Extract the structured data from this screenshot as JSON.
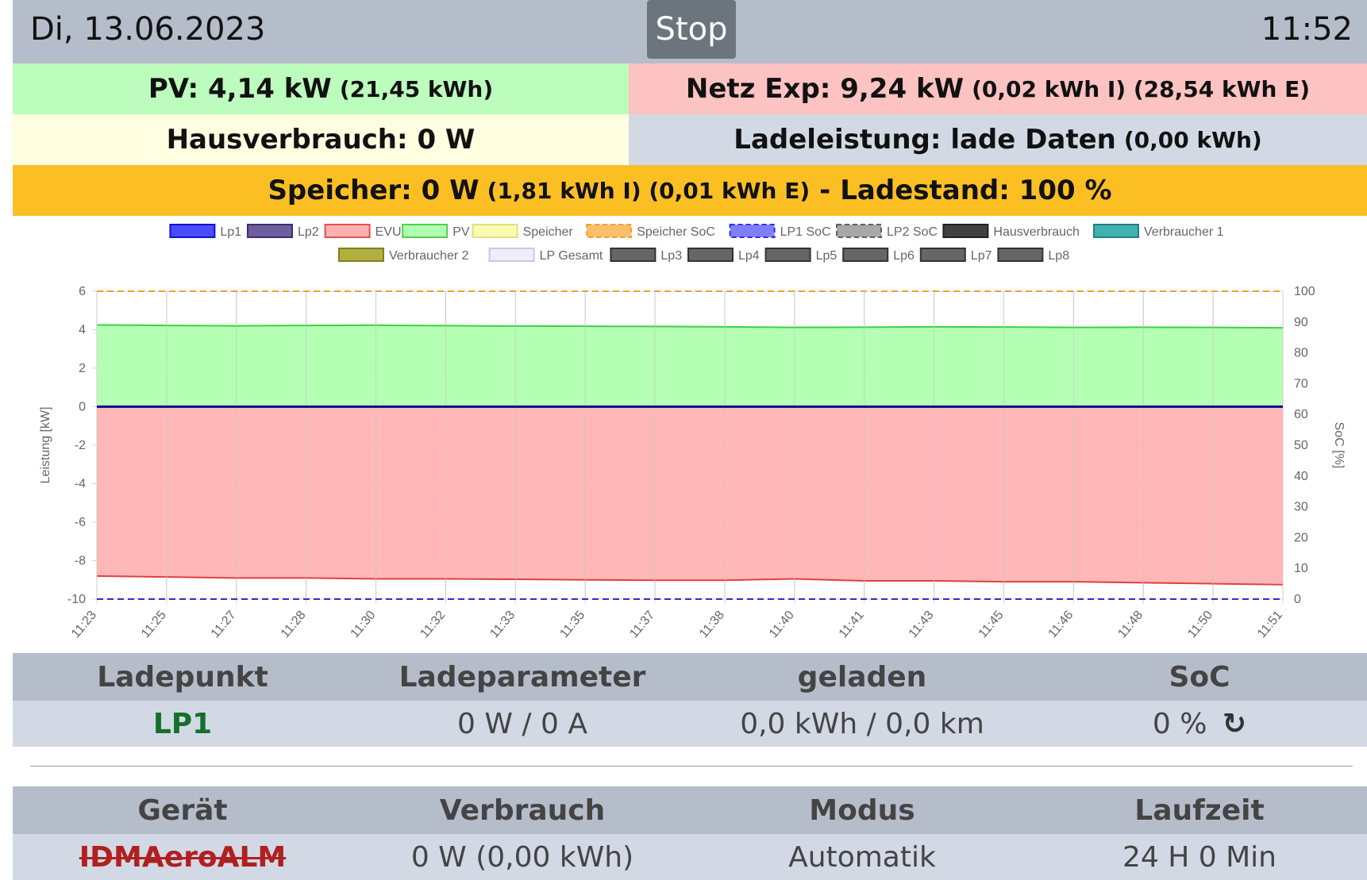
{
  "header": {
    "date": "Di, 13.06.2023",
    "stop_label": "Stop",
    "time": "11:52"
  },
  "pv": {
    "label": "PV: 4,14 kW",
    "detail": "(21,45 kWh)"
  },
  "netz": {
    "label": "Netz Exp: 9,24 kW",
    "detail": "(0,02 kWh I) (28,54 kWh E)"
  },
  "haus": {
    "label": "Hausverbrauch: 0 W"
  },
  "lade": {
    "label": "Ladeleistung: lade Daten",
    "detail": "(0,00 kWh)"
  },
  "speicher": {
    "label": "Speicher: 0 W",
    "detail": "(1,81 kWh I) (0,01 kWh E)",
    "sep": "-",
    "soc": "Ladestand: 100 %"
  },
  "colors": {
    "pv": "#bcfcbd",
    "netz": "#fdc2c2",
    "haus": "#fefee0",
    "lade": "#d3d9e4",
    "speicher": "#fbbf24",
    "header": "#b6bdca"
  },
  "chart_data": {
    "type": "area",
    "legend": [
      "Lp1",
      "Lp2",
      "EVU",
      "PV",
      "Speicher",
      "Speicher SoC",
      "LP1 SoC",
      "LP2 SoC",
      "Hausverbrauch",
      "Verbraucher 1",
      "Verbraucher 2",
      "LP Gesamt",
      "Lp3",
      "Lp4",
      "Lp5",
      "Lp6",
      "Lp7",
      "Lp8"
    ],
    "ylabel": "Leistung [kW]",
    "y2label": "SoC [%]",
    "ylim": [
      -10,
      6
    ],
    "y2lim": [
      0,
      100
    ],
    "yticks": [
      6,
      4,
      2,
      0,
      -2,
      -4,
      -6,
      -8,
      -10
    ],
    "y2ticks": [
      100,
      90,
      80,
      70,
      60,
      50,
      40,
      30,
      20,
      10,
      0
    ],
    "x": [
      "11:23",
      "11:25",
      "11:27",
      "11:28",
      "11:30",
      "11:32",
      "11:33",
      "11:35",
      "11:37",
      "11:38",
      "11:40",
      "11:41",
      "11:43",
      "11:45",
      "11:46",
      "11:48",
      "11:50",
      "11:51"
    ],
    "series": [
      {
        "name": "PV",
        "values": [
          4.25,
          4.22,
          4.2,
          4.22,
          4.23,
          4.21,
          4.19,
          4.18,
          4.17,
          4.15,
          4.12,
          4.13,
          4.15,
          4.14,
          4.12,
          4.13,
          4.12,
          4.1
        ]
      },
      {
        "name": "EVU",
        "values": [
          -8.8,
          -8.85,
          -8.9,
          -8.9,
          -8.95,
          -8.95,
          -8.97,
          -9.0,
          -9.02,
          -9.02,
          -8.95,
          -9.05,
          -9.05,
          -9.1,
          -9.1,
          -9.15,
          -9.2,
          -9.25
        ]
      },
      {
        "name": "Speicher SoC",
        "values": [
          100,
          100,
          100,
          100,
          100,
          100,
          100,
          100,
          100,
          100,
          100,
          100,
          100,
          100,
          100,
          100,
          100,
          100
        ]
      },
      {
        "name": "LP1 SoC",
        "values": [
          0,
          0,
          0,
          0,
          0,
          0,
          0,
          0,
          0,
          0,
          0,
          0,
          0,
          0,
          0,
          0,
          0,
          0
        ]
      },
      {
        "name": "Lp1",
        "values": [
          0,
          0,
          0,
          0,
          0,
          0,
          0,
          0,
          0,
          0,
          0,
          0,
          0,
          0,
          0,
          0,
          0,
          0
        ]
      }
    ]
  },
  "ladepunkte": {
    "headers": [
      "Ladepunkt",
      "Ladeparameter",
      "geladen",
      "SoC"
    ],
    "rows": [
      {
        "name": "LP1",
        "param": "0 W / 0 A",
        "geladen": "0,0 kWh / 0,0 km",
        "soc": "0 %"
      }
    ]
  },
  "geraete": {
    "headers": [
      "Gerät",
      "Verbrauch",
      "Modus",
      "Laufzeit"
    ],
    "rows": [
      {
        "name": "IDMAeroALM",
        "verbrauch": "0 W (0,00 kWh)",
        "modus": "Automatik",
        "laufzeit": "24 H 0 Min"
      }
    ]
  }
}
